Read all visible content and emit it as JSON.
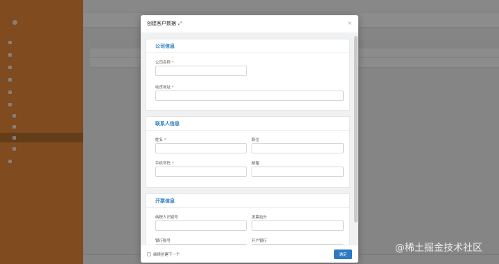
{
  "modal": {
    "title": "创建客户数据",
    "continue_label": "继续创建下一个",
    "ok_label": "确定"
  },
  "sections": {
    "company": {
      "title": "公司信息",
      "fields": {
        "company_name": "公司名称",
        "shipping_address": "收货地址"
      }
    },
    "contact": {
      "title": "联系人信息",
      "fields": {
        "name": "姓名",
        "position": "职位",
        "phone": "手机号码",
        "email": "邮箱"
      }
    },
    "invoice": {
      "title": "开票信息",
      "fields": {
        "taxpayer_id": "纳税人识别号",
        "invoice_title": "发票抬头",
        "bank_account": "银行账号",
        "bank_name": "开户银行"
      }
    }
  },
  "required_mark": "*",
  "watermark": "@稀土掘金技术社区",
  "colors": {
    "sidebar": "#e8893a",
    "accent": "#2a7ac2"
  }
}
